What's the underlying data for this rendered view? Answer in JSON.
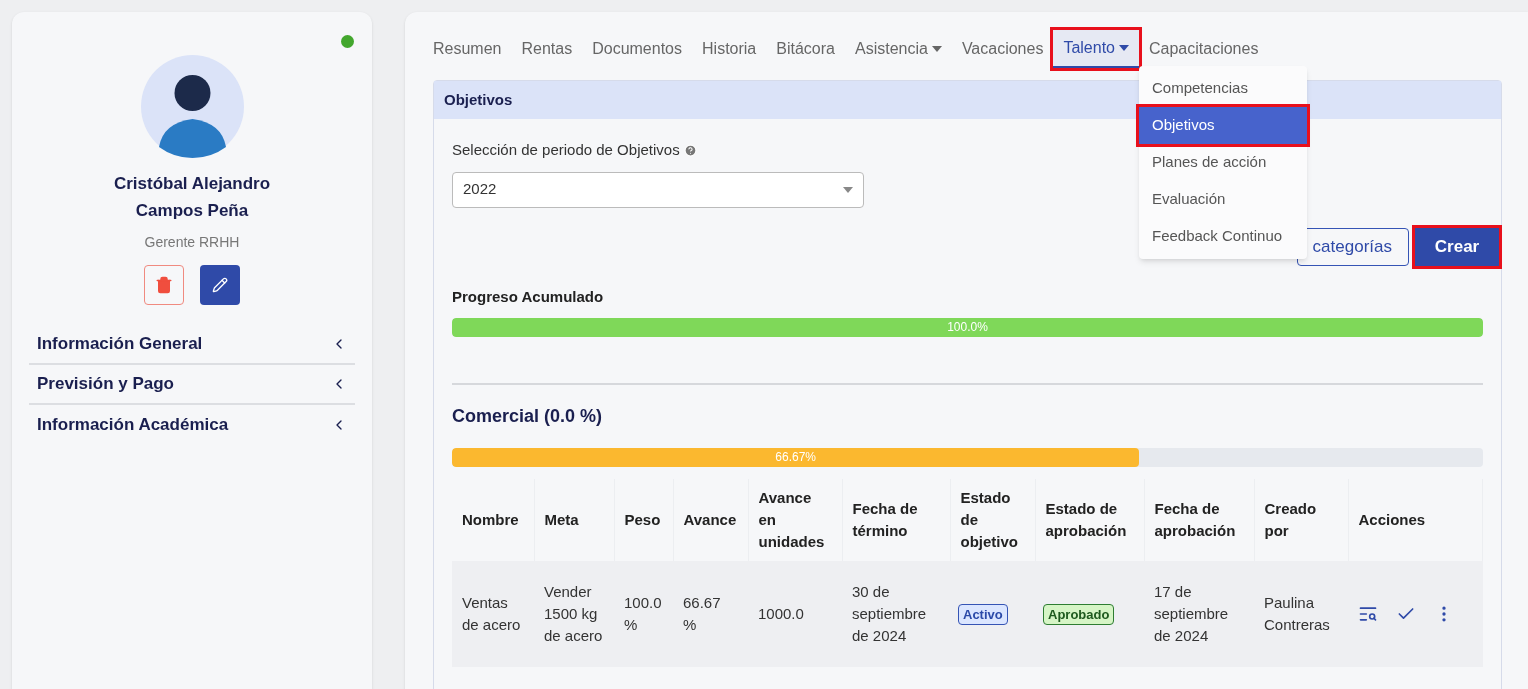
{
  "profile": {
    "online": true,
    "name": "Cristóbal Alejandro Campos Peña",
    "role": "Gerente RRHH",
    "sections": [
      {
        "label": "Información General",
        "expanded": false
      },
      {
        "label": "Previsión y Pago",
        "expanded": false
      },
      {
        "label": "Información Académica",
        "expanded": false
      }
    ]
  },
  "tabs": [
    {
      "label": "Resumen",
      "selected": false,
      "dropdown": false,
      "highlighted": false
    },
    {
      "label": "Rentas",
      "selected": false,
      "dropdown": false,
      "highlighted": false
    },
    {
      "label": "Documentos",
      "selected": false,
      "dropdown": false,
      "highlighted": false
    },
    {
      "label": "Historia",
      "selected": false,
      "dropdown": false,
      "highlighted": false
    },
    {
      "label": "Bitácora",
      "selected": false,
      "dropdown": false,
      "highlighted": false
    },
    {
      "label": "Asistencia",
      "selected": false,
      "dropdown": true,
      "highlighted": false
    },
    {
      "label": "Vacaciones",
      "selected": false,
      "dropdown": false,
      "highlighted": false
    },
    {
      "label": "Talento",
      "selected": true,
      "dropdown": true,
      "highlighted": true
    },
    {
      "label": "Capacitaciones",
      "selected": false,
      "dropdown": false,
      "highlighted": false
    }
  ],
  "menu": [
    {
      "label": "Competencias",
      "selected": false,
      "highlighted": false
    },
    {
      "label": "Objetivos",
      "selected": true,
      "highlighted": true
    },
    {
      "label": "Planes de acción",
      "selected": false,
      "highlighted": false
    },
    {
      "label": "Evaluación",
      "selected": false,
      "highlighted": false
    },
    {
      "label": "Feedback Continuo",
      "selected": false,
      "highlighted": false
    }
  ],
  "panel": {
    "title": "Objetivos",
    "period_label": "Selección de periodo de Objetivos",
    "period_value": "2022",
    "categories_button": "categorías",
    "create_button": {
      "label": "Crear",
      "highlighted": true
    },
    "total": {
      "label": "Progreso Acumulado",
      "level": 1.0,
      "reading": "100.0%"
    },
    "category": {
      "title": "Comercial (0.0 %)",
      "level": 0.6667,
      "reading": "66.67%"
    },
    "table": {
      "columns": [
        "Nombre",
        "Meta",
        "Peso",
        "Avance",
        "Avance en unidades",
        "Fecha de término",
        "Estado de objetivo",
        "Estado de aprobación",
        "Fecha de aprobación",
        "Creado por",
        "Acciones"
      ],
      "rows": [
        {
          "name": "Ventas de acero",
          "goal": "Vender 1500 kg de acero",
          "weight": "100.0 %",
          "progress": "66.67 %",
          "units": "1000.0",
          "due": "30 de septiembre de 2024",
          "status": {
            "label": "Activo",
            "kind": "info"
          },
          "approval": {
            "label": "Aprobado",
            "kind": "success"
          },
          "approved_on": "17 de septiembre de 2024",
          "created_by": "Paulina Contreras"
        }
      ]
    }
  }
}
